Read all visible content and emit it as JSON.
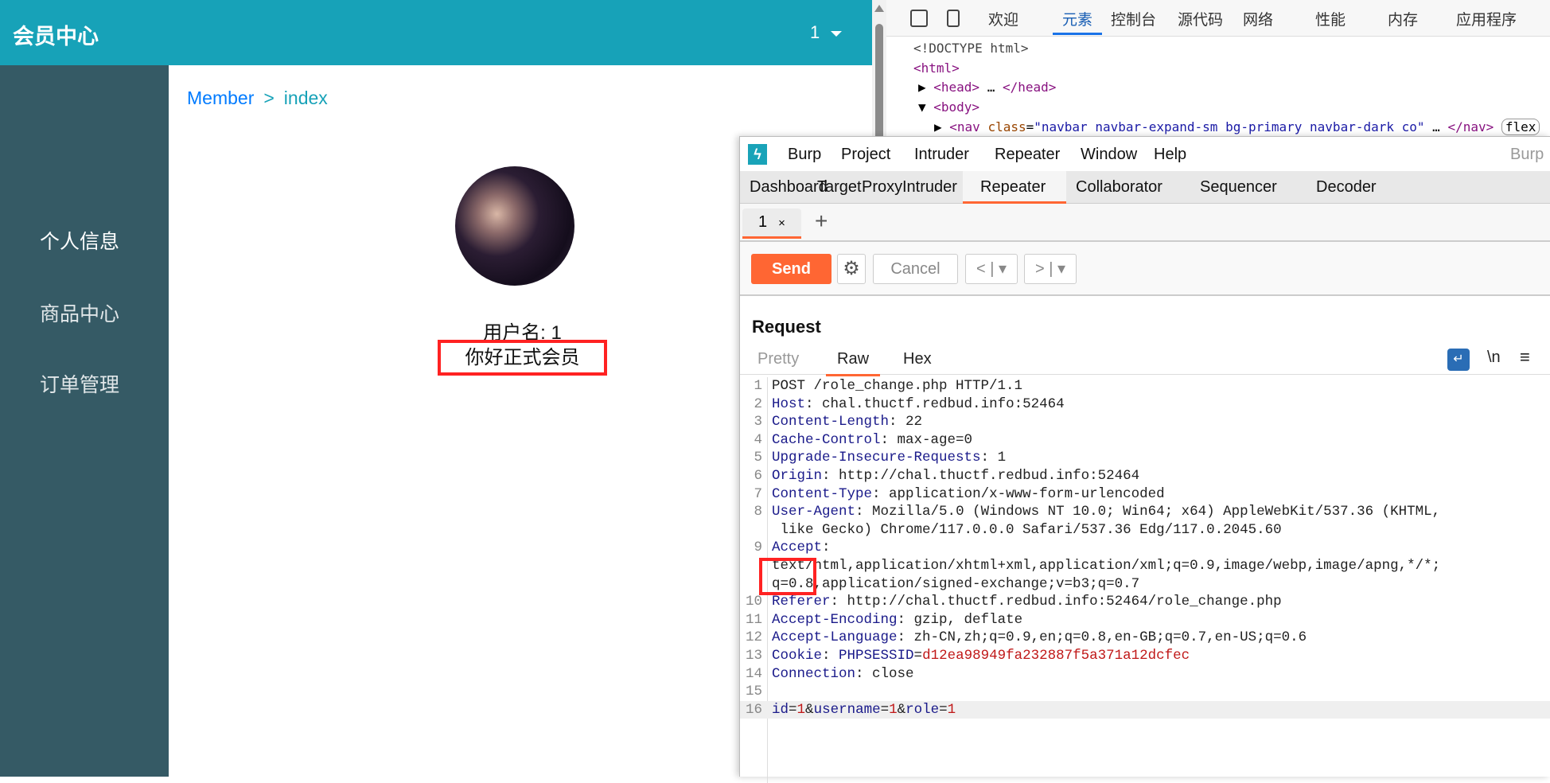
{
  "site": {
    "brand": "会员中心",
    "user_menu": "1",
    "sidebar": [
      {
        "label": "个人信息",
        "active": true
      },
      {
        "label": "商品中心"
      },
      {
        "label": "订单管理"
      }
    ],
    "breadcrumb": {
      "parent": "Member",
      "sep": ">",
      "current": "index"
    },
    "username_line": "用户名: 1",
    "welcome": "你好正式会员"
  },
  "devtools": {
    "tabs": [
      "欢迎",
      "元素",
      "控制台",
      "源代码",
      "网络",
      "性能",
      "内存",
      "应用程序"
    ],
    "active_tab": "元素",
    "dom": {
      "doctype": "<!DOCTYPE html>",
      "html": "<html>",
      "head_open": "<head>",
      "head_close": "</head>",
      "body": "<body>",
      "nav_open": "<nav",
      "nav_attr": "class",
      "nav_val": "\"navbar navbar-expand-sm bg-primary navbar-dark co\"",
      "nav_close": "</nav>",
      "badge": "flex"
    }
  },
  "burp": {
    "menu": [
      "Burp",
      "Project",
      "Intruder",
      "Repeater",
      "Window",
      "Help"
    ],
    "title_fragment": "Burp",
    "tabs": [
      "Dashboard",
      "Target",
      "Proxy",
      "Intruder",
      "Repeater",
      "Collaborator",
      "Sequencer",
      "Decoder"
    ],
    "active_tab": "Repeater",
    "subtab": "1",
    "subtab_close": "×",
    "add_tab": "+",
    "toolbar": {
      "send": "Send",
      "cancel": "Cancel",
      "back": "<",
      "forward": ">",
      "dropdown": "▾"
    },
    "request": {
      "title": "Request",
      "views": [
        "Pretty",
        "Raw",
        "Hex"
      ],
      "active_view": "Raw",
      "newline_label": "\\n",
      "lines": [
        {
          "n": "1",
          "k": "",
          "v": "POST /role_change.php HTTP/1.1"
        },
        {
          "n": "2",
          "k": "Host",
          "v": "chal.thuctf.redbud.info:52464"
        },
        {
          "n": "3",
          "k": "Content-Length",
          "v": "22"
        },
        {
          "n": "4",
          "k": "Cache-Control",
          "v": "max-age=0"
        },
        {
          "n": "5",
          "k": "Upgrade-Insecure-Requests",
          "v": "1"
        },
        {
          "n": "6",
          "k": "Origin",
          "v": "http://chal.thuctf.redbud.info:52464"
        },
        {
          "n": "7",
          "k": "Content-Type",
          "v": "application/x-www-form-urlencoded"
        },
        {
          "n": "8",
          "k": "User-Agent",
          "v": "Mozilla/5.0 (Windows NT 10.0; Win64; x64) AppleWebKit/537.36 (KHTML,"
        },
        {
          "n": "",
          "k": "",
          "v": " like Gecko) Chrome/117.0.0.0 Safari/537.36 Edg/117.0.2045.60"
        },
        {
          "n": "9",
          "k": "Accept",
          "v": ""
        },
        {
          "n": "",
          "k": "",
          "v": "text/html,application/xhtml+xml,application/xml;q=0.9,image/webp,image/apng,*/*;"
        },
        {
          "n": "",
          "k": "",
          "v": "q=0.8,application/signed-exchange;v=b3;q=0.7"
        },
        {
          "n": "10",
          "k": "Referer",
          "v": "http://chal.thuctf.redbud.info:52464/role_change.php"
        },
        {
          "n": "11",
          "k": "Accept-Encoding",
          "v": "gzip, deflate"
        },
        {
          "n": "12",
          "k": "Accept-Language",
          "v": "zh-CN,zh;q=0.9,en;q=0.8,en-GB;q=0.7,en-US;q=0.6"
        },
        {
          "n": "13",
          "k": "Cookie",
          "v": "",
          "cookie_name": "PHPSESSID",
          "cookie_val": "d12ea98949fa232887f5a371a12dcfec"
        },
        {
          "n": "14",
          "k": "Connection",
          "v": "close"
        },
        {
          "n": "15",
          "k": "",
          "v": ""
        }
      ],
      "body_line": {
        "n": "16",
        "params": [
          {
            "k": "id",
            "v": "1"
          },
          {
            "k": "username",
            "v": "1"
          },
          {
            "k": "role",
            "v": "1"
          }
        ]
      }
    }
  },
  "colors": {
    "navbar": "#17a2b8",
    "sidebar": "#355a65",
    "burp_accent": "#ff6633",
    "highlight": "#ff2222"
  }
}
